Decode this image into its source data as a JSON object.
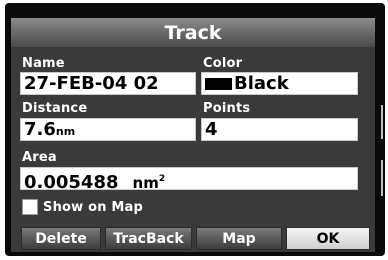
{
  "window": {
    "title": "Track"
  },
  "fields": {
    "name": {
      "label": "Name",
      "value": "27-FEB-04 02"
    },
    "color": {
      "label": "Color",
      "value": "Black",
      "swatch": "#000000"
    },
    "distance": {
      "label": "Distance",
      "value": "7.6",
      "unit": "nm"
    },
    "points": {
      "label": "Points",
      "value": "4"
    },
    "area": {
      "label": "Area",
      "value": "0.005488",
      "unit": "nm",
      "unit_exp": "2"
    }
  },
  "show_on_map": {
    "label": "Show on Map",
    "checked": false
  },
  "buttons": {
    "delete": "Delete",
    "tracback": "TracBack",
    "map": "Map",
    "ok": "OK"
  },
  "colors": {
    "frame": "#0a0a0a",
    "panel": "#3a3a3a",
    "selected_button": "#e6e6e6"
  }
}
